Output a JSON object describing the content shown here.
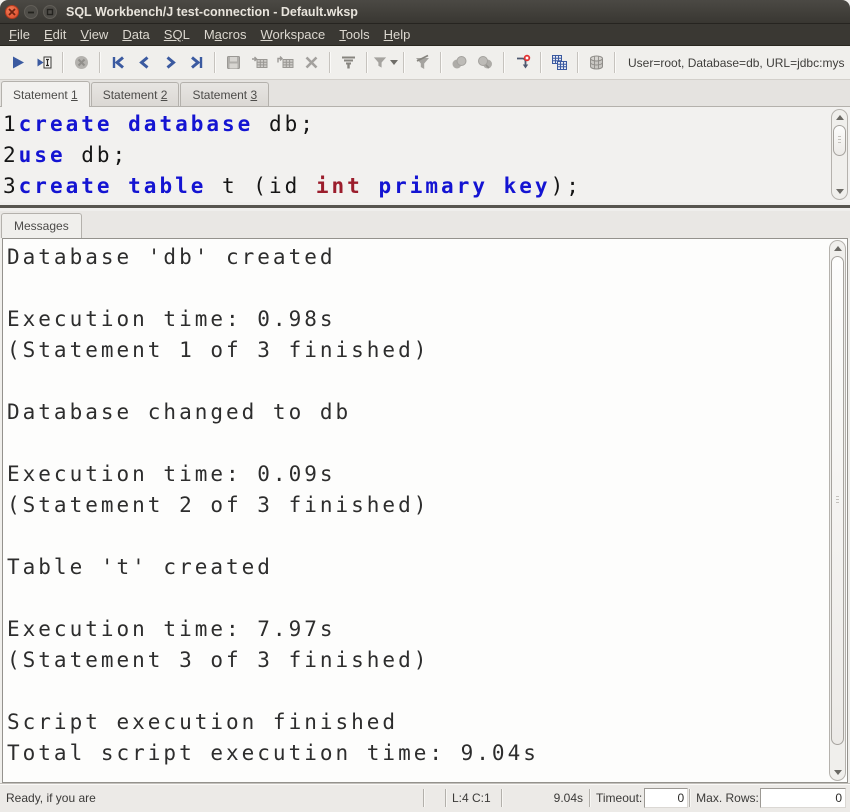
{
  "window": {
    "title": "SQL Workbench/J test-connection - Default.wksp",
    "controls": {
      "close": "close",
      "minimize": "minimize",
      "maximize": "maximize"
    }
  },
  "menu": {
    "items": [
      {
        "pre": "",
        "u": "F",
        "post": "ile"
      },
      {
        "pre": "",
        "u": "E",
        "post": "dit"
      },
      {
        "pre": "",
        "u": "V",
        "post": "iew"
      },
      {
        "pre": "",
        "u": "D",
        "post": "ata"
      },
      {
        "pre": "",
        "u": "SQ",
        "post": "L"
      },
      {
        "pre": "M",
        "u": "a",
        "post": "cros"
      },
      {
        "pre": "",
        "u": "W",
        "post": "orkspace"
      },
      {
        "pre": "",
        "u": "T",
        "post": "ools"
      },
      {
        "pre": "",
        "u": "H",
        "post": "elp"
      }
    ]
  },
  "toolbar": {
    "connection_info": "User=root, Database=db, URL=jdbc:mysq",
    "icons": [
      "execute-all",
      "execute-current",
      "cancel",
      "first-statement",
      "previous-statement",
      "next-statement",
      "last-statement",
      "save",
      "insert-row",
      "copy-row",
      "delete-row",
      "filter",
      "filter-dropdown",
      "reset-filter",
      "commit",
      "rollback",
      "ignore-errors",
      "table-list",
      "database"
    ]
  },
  "statement_tabs": [
    {
      "pre": "Statement ",
      "u": "1",
      "post": "",
      "active": true
    },
    {
      "pre": "Statement ",
      "u": "2",
      "post": "",
      "active": false
    },
    {
      "pre": "Statement ",
      "u": "3",
      "post": "",
      "active": false
    }
  ],
  "editor": {
    "line1": {
      "num": "1",
      "kw1": "create database",
      "txt1": " db;"
    },
    "line2": {
      "num": "2",
      "kw1": "use",
      "txt1": " db;"
    },
    "line3": {
      "num": "3",
      "kw1": "create table",
      "mid": " t (id ",
      "type1": "int",
      "sp": " ",
      "kw2": "primary key",
      "end": ");"
    }
  },
  "messages_tab": {
    "label": "Messages"
  },
  "messages": {
    "lines": [
      "Database 'db' created",
      "",
      "Execution time: 0.98s",
      "(Statement 1 of 3 finished)",
      "",
      "Database changed to db",
      "",
      "Execution time: 0.09s",
      "(Statement 2 of 3 finished)",
      "",
      "Table 't' created",
      "",
      "Execution time: 7.97s",
      "(Statement 3 of 3 finished)",
      "",
      "Script execution finished",
      "Total script execution time: 9.04s"
    ]
  },
  "status_bar": {
    "ready_text": "Ready, if you are",
    "cursor_position": "L:4 C:1",
    "exec_time": "9.04s",
    "timeout_label": "Timeout:",
    "timeout_value": "0",
    "max_rows_label": "Max. Rows:",
    "max_rows_value": "0"
  },
  "colors": {
    "keyword_blue": "#1414d2",
    "datatype_red": "#9b1d2c",
    "toolbar_arrow_blue": "#3b5aa0",
    "close_button_orange": "#dd4b2b",
    "titlebar_dark": "#3a3833",
    "editor_bg": "#f2f1ef",
    "messages_bg": "#fdfdfc"
  }
}
